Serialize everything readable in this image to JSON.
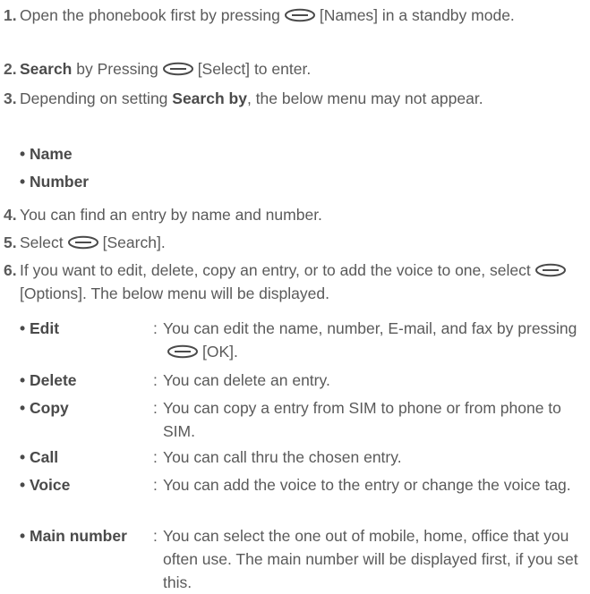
{
  "steps": {
    "s1": {
      "num": "1.",
      "pre": "Open the phonebook first by pressing",
      "key": "[Names]",
      "post": "in a standby mode."
    },
    "s2": {
      "num": "2.",
      "bold": "Search",
      "pre": "by Pressing",
      "key": "[Select]",
      "post": "to enter."
    },
    "s3": {
      "num": "3.",
      "pre": "Depending on setting",
      "bold": "Search by",
      "post": ", the below menu may not appear."
    },
    "s4": {
      "num": "4.",
      "text": "You can find an entry by name and number."
    },
    "s5": {
      "num": "5.",
      "pre": "Select",
      "key": "[Search]."
    },
    "s6": {
      "num": "6.",
      "pre": "If you want to edit, delete, copy an entry, or to add the voice to one, select",
      "key": "[Options].",
      "post": "The below menu will be displayed."
    }
  },
  "search_options": [
    {
      "label": "• Name"
    },
    {
      "label": "• Number"
    }
  ],
  "menu_options": [
    {
      "term": "• Edit",
      "colon": ":",
      "desc_pre": "You can edit the name, number, E-mail, and fax by pressing",
      "key": "[OK]."
    },
    {
      "term": "• Delete",
      "colon": ":",
      "desc": "You can delete an entry."
    },
    {
      "term": "• Copy",
      "colon": ":",
      "desc": "You can copy a entry from SIM to phone or from phone to SIM."
    },
    {
      "term": "• Call",
      "colon": ":",
      "desc": "You can call thru the chosen entry."
    },
    {
      "term": "• Voice",
      "colon": ":",
      "desc": "You can add the voice to the entry or change the voice tag."
    },
    {
      "term": "• Main number",
      "colon": ":",
      "desc": "You can select the one out of mobile, home, office that you often use. The main number will be displayed first, if you set this."
    }
  ],
  "icons": {
    "soft_key": "soft-key-icon"
  },
  "colors": {
    "text": "#5a5a5a"
  }
}
